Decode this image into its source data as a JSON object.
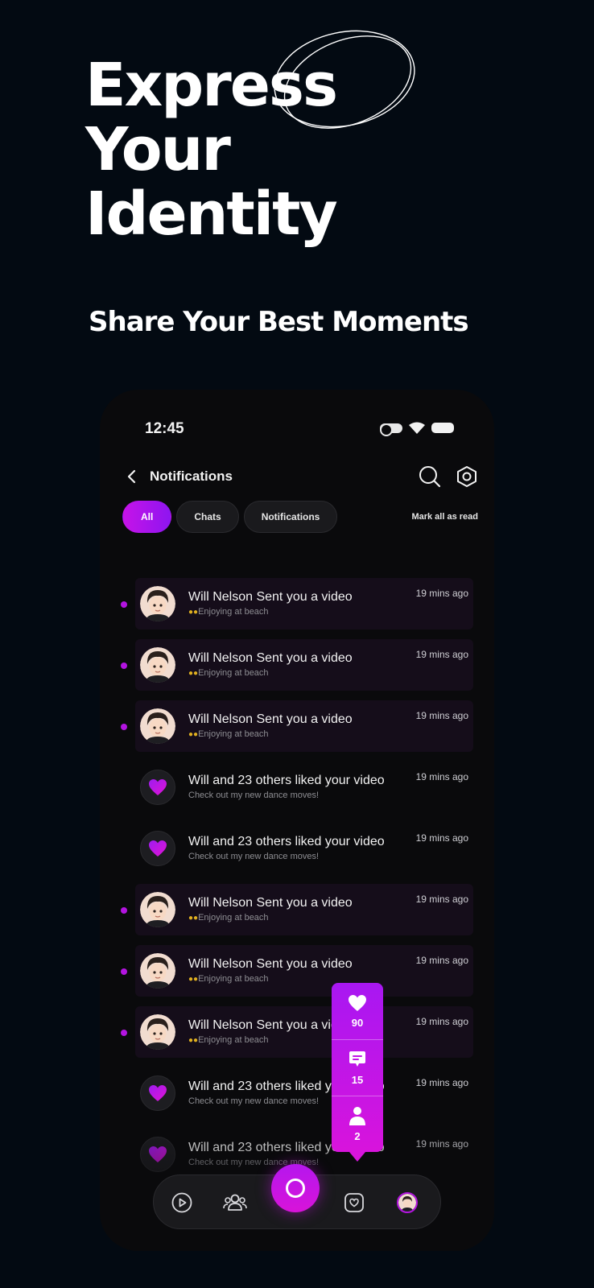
{
  "hero": {
    "title_lines": [
      "Express",
      "Your",
      "Identity"
    ],
    "subtitle": "Share Your Best Moments"
  },
  "status_bar": {
    "time": "12:45"
  },
  "header": {
    "title": "Notifications",
    "icons": [
      "chevron-left-icon",
      "search-icon",
      "settings-hex-icon"
    ]
  },
  "filters": {
    "chips": [
      {
        "label": "All",
        "active": true
      },
      {
        "label": "Chats",
        "active": false
      },
      {
        "label": "Notifications",
        "active": false
      }
    ],
    "mark_all_read": "Mark all as read"
  },
  "notifications": [
    {
      "type": "video",
      "unread": true,
      "title": "Will Nelson Sent you a video",
      "subtitle": "Enjoying at beach",
      "time": "19 mins ago"
    },
    {
      "type": "video",
      "unread": true,
      "title": "Will Nelson Sent you a video",
      "subtitle": "Enjoying at beach",
      "time": "19 mins ago"
    },
    {
      "type": "video",
      "unread": true,
      "title": "Will Nelson Sent you a video",
      "subtitle": "Enjoying at beach",
      "time": "19 mins ago"
    },
    {
      "type": "like",
      "unread": false,
      "title": "Will and 23 others liked your video",
      "subtitle": "Check out my new dance moves!",
      "time": "19 mins ago"
    },
    {
      "type": "like",
      "unread": false,
      "title": "Will and 23 others liked your video",
      "subtitle": "Check out my new dance moves!",
      "time": "19 mins ago"
    },
    {
      "type": "video",
      "unread": true,
      "title": "Will Nelson Sent you a video",
      "subtitle": "Enjoying at beach",
      "time": "19 mins ago"
    },
    {
      "type": "video",
      "unread": true,
      "title": "Will Nelson Sent you a video",
      "subtitle": "Enjoying at beach",
      "time": "19 mins ago"
    },
    {
      "type": "video",
      "unread": true,
      "title": "Will Nelson Sent you a video",
      "subtitle": "Enjoying at beach",
      "time": "19 mins ago"
    },
    {
      "type": "like",
      "unread": false,
      "title": "Will and 23 others liked your video",
      "subtitle": "Check out my new dance moves!",
      "time": "19 mins ago"
    },
    {
      "type": "like",
      "unread": false,
      "title": "Will and 23 others liked your video",
      "subtitle": "Check out my new dance moves!",
      "time": "19 mins ago"
    }
  ],
  "activity_tooltip": {
    "likes": "90",
    "comments": "15",
    "followers": "2"
  },
  "bottom_nav": {
    "icons": [
      "play-icon",
      "community-icon",
      "create-icon",
      "inbox-icon",
      "profile-avatar"
    ]
  },
  "colors": {
    "background": "#030a12",
    "accent": "#b314e0",
    "accent_pink": "#d814dc",
    "unread_row": "#150d1a"
  }
}
